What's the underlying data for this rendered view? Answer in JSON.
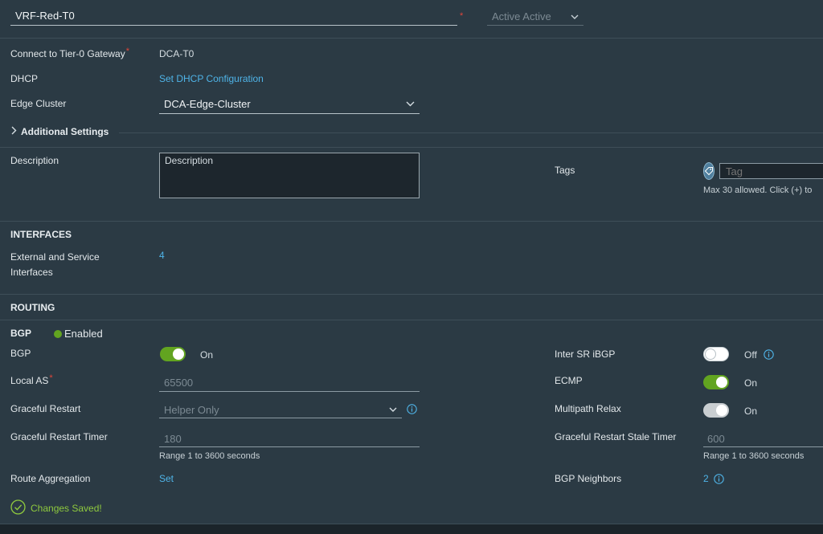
{
  "header": {
    "name_value": "VRF-Red-T0",
    "ha_mode": "Active Active"
  },
  "general": {
    "connect_label": "Connect to Tier-0 Gateway",
    "connect_value": "DCA-T0",
    "dhcp_label": "DHCP",
    "dhcp_link": "Set DHCP Configuration",
    "edge_cluster_label": "Edge Cluster",
    "edge_cluster_value": "DCA-Edge-Cluster",
    "additional_settings": "Additional Settings",
    "description_label": "Description",
    "description_placeholder": "Description",
    "tags_label": "Tags",
    "tag_placeholder": "Tag",
    "tags_hint": "Max 30 allowed. Click (+) to"
  },
  "interfaces": {
    "section_title": "INTERFACES",
    "ext_label_line1": "External and Service",
    "ext_label_line2": "Interfaces",
    "ext_count": "4"
  },
  "routing": {
    "section_title": "ROUTING"
  },
  "bgp": {
    "header_label": "BGP",
    "status": "Enabled",
    "bgp_label": "BGP",
    "bgp_toggle": "On",
    "local_as_label": "Local AS",
    "local_as_value": "65500",
    "graceful_restart_label": "Graceful Restart",
    "graceful_restart_value": "Helper Only",
    "gr_timer_label": "Graceful Restart Timer",
    "gr_timer_value": "180",
    "gr_timer_hint": "Range 1 to 3600 seconds",
    "route_agg_label": "Route Aggregation",
    "route_agg_link": "Set",
    "inter_sr_label": "Inter SR iBGP",
    "inter_sr_toggle": "Off",
    "ecmp_label": "ECMP",
    "ecmp_toggle": "On",
    "multipath_label": "Multipath Relax",
    "multipath_toggle": "On",
    "stale_timer_label": "Graceful Restart Stale Timer",
    "stale_timer_value": "600",
    "stale_timer_hint": "Range 1 to 3600 seconds",
    "neighbors_label": "BGP Neighbors",
    "neighbors_count": "2"
  },
  "status": {
    "message": "Changes Saved!"
  },
  "colors": {
    "background": "#2b3a44",
    "link": "#4fb4e8",
    "toggle_on": "#62a420",
    "required": "#e0463b",
    "success": "#8fca3e"
  }
}
